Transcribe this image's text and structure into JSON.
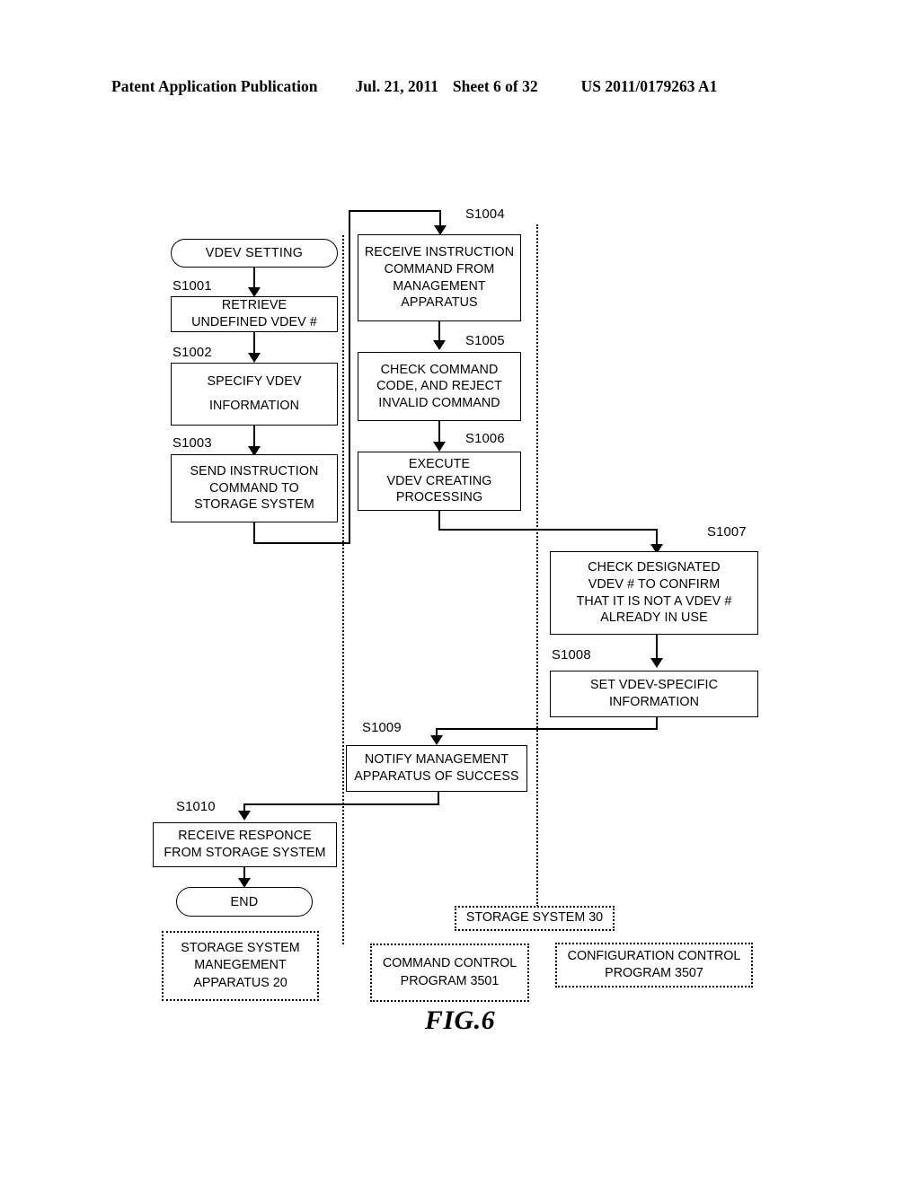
{
  "header": {
    "publication": "Patent Application Publication",
    "date": "Jul. 21, 2011",
    "sheet": "Sheet 6 of 32",
    "number": "US 2011/0179263 A1"
  },
  "figure": {
    "caption": "FIG.6",
    "start_terminator": "VDEV SETTING",
    "end_terminator": "END",
    "steps": [
      {
        "id": "S1001",
        "label": "S1001",
        "lines": [
          "RETRIEVE",
          "UNDEFINED VDEV #"
        ]
      },
      {
        "id": "S1002",
        "label": "S1002",
        "lines": [
          "SPECIFY VDEV",
          "INFORMATION"
        ]
      },
      {
        "id": "S1003",
        "label": "S1003",
        "lines": [
          "SEND INSTRUCTION",
          "COMMAND TO",
          "STORAGE SYSTEM"
        ]
      },
      {
        "id": "S1004",
        "label": "S1004",
        "lines": [
          "RECEIVE INSTRUCTION",
          "COMMAND FROM",
          "MANAGEMENT",
          "APPARATUS"
        ]
      },
      {
        "id": "S1005",
        "label": "S1005",
        "lines": [
          "CHECK COMMAND",
          "CODE, AND REJECT",
          "INVALID COMMAND"
        ]
      },
      {
        "id": "S1006",
        "label": "S1006",
        "lines": [
          "EXECUTE",
          "VDEV CREATING",
          "PROCESSING"
        ]
      },
      {
        "id": "S1007",
        "label": "S1007",
        "lines": [
          "CHECK DESIGNATED",
          "VDEV # TO CONFIRM",
          "THAT IT IS NOT A VDEV #",
          "ALREADY IN USE"
        ]
      },
      {
        "id": "S1008",
        "label": "S1008",
        "lines": [
          "SET VDEV-SPECIFIC",
          "INFORMATION"
        ]
      },
      {
        "id": "S1009",
        "label": "S1009",
        "lines": [
          "NOTIFY MANAGEMENT",
          "APPARATUS OF SUCCESS"
        ]
      },
      {
        "id": "S1010",
        "label": "S1010",
        "lines": [
          "RECEIVE RESPONCE",
          "FROM STORAGE SYSTEM"
        ]
      }
    ],
    "lanes": [
      {
        "id": "management-apparatus",
        "lines": [
          "STORAGE SYSTEM",
          "MANEGEMENT",
          "APPARATUS 20"
        ]
      },
      {
        "id": "command-control-program",
        "lines": [
          "COMMAND CONTROL",
          "PROGRAM 3501"
        ]
      },
      {
        "id": "configuration-control-program",
        "lines": [
          "CONFIGURATION CONTROL",
          "PROGRAM 3507"
        ]
      },
      {
        "id": "storage-system",
        "lines": [
          "STORAGE SYSTEM 30"
        ]
      }
    ]
  }
}
